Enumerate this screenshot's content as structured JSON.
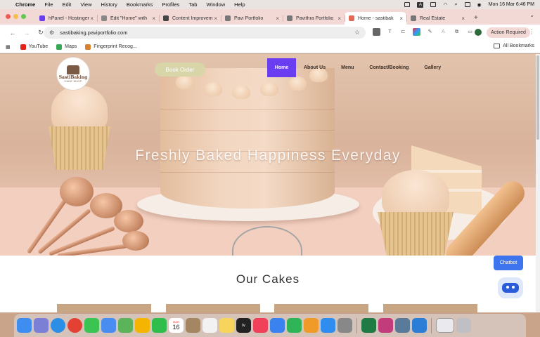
{
  "menubar": {
    "app": "Chrome",
    "items": [
      "File",
      "Edit",
      "View",
      "History",
      "Bookmarks",
      "Profiles",
      "Tab",
      "Window",
      "Help"
    ],
    "clock": "Mon 16 Mar  6:46 PM"
  },
  "tabs": [
    {
      "label": "hPanel - Hostinger",
      "color": "#6a3df0"
    },
    {
      "label": "Edit \"Home\" with",
      "color": "#888888"
    },
    {
      "label": "Content Improvem",
      "color": "#444444"
    },
    {
      "label": "Pavi Portfolio",
      "color": "#777777"
    },
    {
      "label": "Pavithra Portfolio",
      "color": "#777777"
    },
    {
      "label": "Home - sastibak",
      "color": "#e06a55"
    },
    {
      "label": "Real Estate",
      "color": "#777777"
    }
  ],
  "toolbar": {
    "url": "sastibaking.paviportfolio.com",
    "action_label": "Action Required"
  },
  "bookmarks": [
    {
      "label": "YouTube",
      "color": "#e62117"
    },
    {
      "label": "Maps",
      "color": "#34a853"
    },
    {
      "label": "Fingerprint Recog...",
      "color": "#d9822b"
    }
  ],
  "all_bookmarks": "All Bookmarks",
  "site": {
    "logo_title": "SastiBaking",
    "logo_sub": "CAKE SHOP",
    "book_button": "Book Order",
    "nav": [
      "Home",
      "About Us",
      "Menu",
      "Contact/Booking",
      "Gallery"
    ],
    "headline": "Freshly Baked Happiness Everyday",
    "section_title": "Our Cakes",
    "chatbot_label": "Chatbot"
  },
  "dock": {
    "icons": [
      {
        "name": "finder-icon",
        "color": "#3d8ef0"
      },
      {
        "name": "launchpad-icon",
        "color": "#7b7fd6"
      },
      {
        "name": "safari-icon",
        "color": "#2d8ee6"
      },
      {
        "name": "chrome-icon",
        "color": "#e34133"
      },
      {
        "name": "messages-icon",
        "color": "#3bc452"
      },
      {
        "name": "mail-icon",
        "color": "#4a8df0"
      },
      {
        "name": "maps-icon",
        "color": "#5bb45a"
      },
      {
        "name": "photos-icon",
        "color": "#f4b400"
      },
      {
        "name": "facetime-icon",
        "color": "#2fbd4b"
      },
      {
        "name": "calendar-icon",
        "color": "#ffffff"
      },
      {
        "name": "finder-archive-icon",
        "color": "#a58663"
      },
      {
        "name": "reminders-icon",
        "color": "#f2f2f2"
      },
      {
        "name": "notes-icon",
        "color": "#f7d55c"
      },
      {
        "name": "appletv-icon",
        "color": "#222222"
      },
      {
        "name": "music-icon",
        "color": "#f0405a"
      },
      {
        "name": "keynote-icon",
        "color": "#3a82f0"
      },
      {
        "name": "numbers-icon",
        "color": "#2fb457"
      },
      {
        "name": "pages-icon",
        "color": "#f09a2a"
      },
      {
        "name": "appstore-icon",
        "color": "#2f8df0"
      },
      {
        "name": "settings-icon",
        "color": "#888888"
      },
      {
        "name": "excel-icon",
        "color": "#1f7a43"
      },
      {
        "name": "affinity-icon",
        "color": "#c23b7a"
      },
      {
        "name": "preview-icon",
        "color": "#5a7a9a"
      },
      {
        "name": "vscode-icon",
        "color": "#2b7dd6"
      }
    ],
    "calendar_month": "MAR",
    "calendar_day": "16",
    "appletv_label": "tv"
  }
}
